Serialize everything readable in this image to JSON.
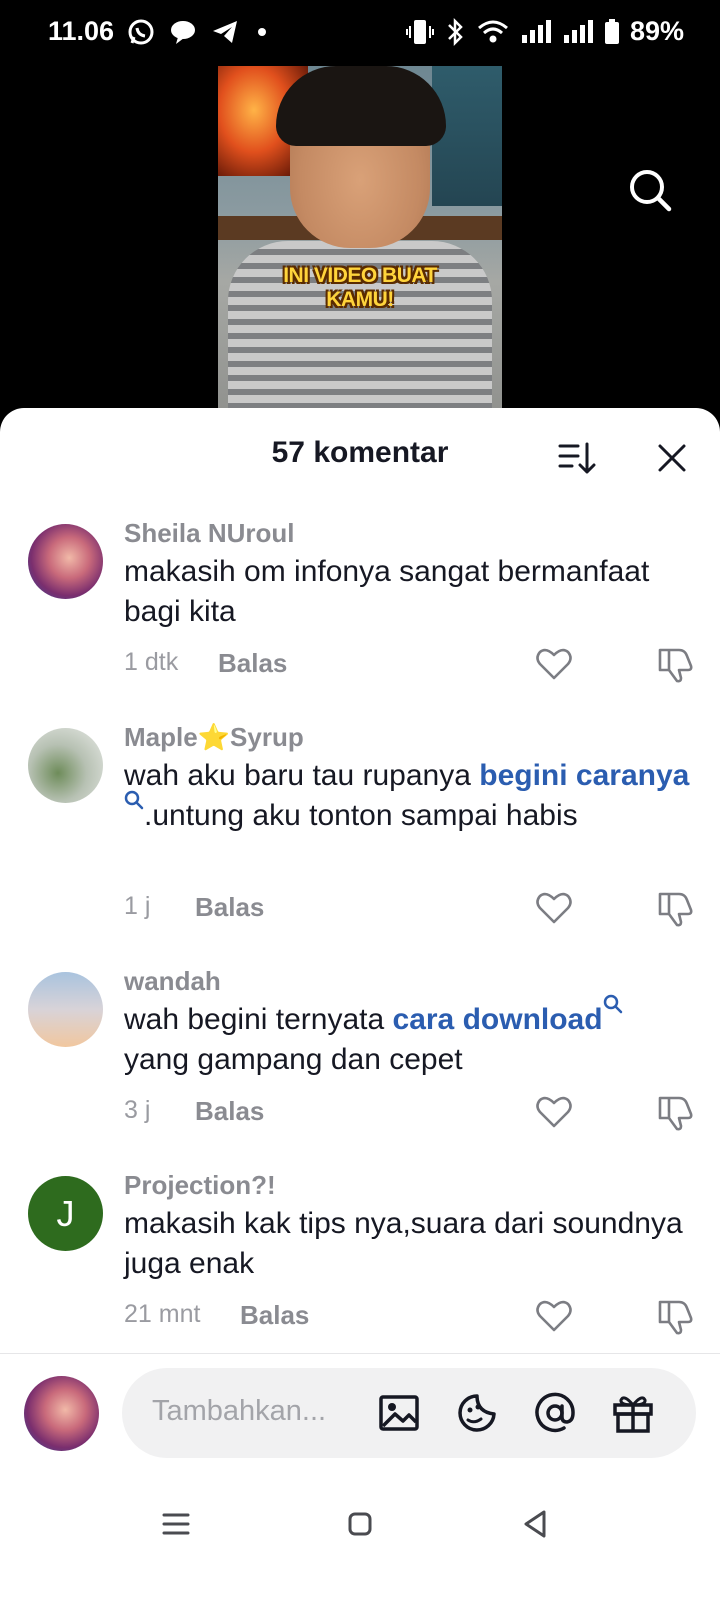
{
  "status_bar": {
    "time": "11.06",
    "battery": "89%",
    "icons": [
      "whatsapp-icon",
      "chat-icon",
      "telegram-icon",
      "dot-icon",
      "vibrate-icon",
      "bluetooth-icon",
      "wifi-icon",
      "signal-icon",
      "signal-icon",
      "battery-icon"
    ]
  },
  "video": {
    "caption_line1": "INI VIDEO BUAT",
    "caption_line2": "KAMU!",
    "search_icon": "search-icon"
  },
  "comments_panel": {
    "title": "57 komentar",
    "sort_icon": "sort-icon",
    "close_icon": "close-icon",
    "comments": [
      {
        "user": "Sheila NUroul",
        "text": "makasih om infonya sangat bermanfaat bagi kita",
        "time": "1 dtk",
        "reply_label": "Balas"
      },
      {
        "user": "Maple⭐Syrup",
        "text_before": "wah aku baru tau rupanya ",
        "link": "begini caranya",
        "text_after": ".untung aku tonton sampai habis",
        "time": "1 j",
        "reply_label": "Balas"
      },
      {
        "user": "wandah",
        "text_before": "wah begini ternyata ",
        "link": "cara download",
        "text_after": " yang gampang dan cepet",
        "time": "3 j",
        "reply_label": "Balas"
      },
      {
        "user": "Projection?!",
        "avatar_letter": "J",
        "text": "makasih kak tips nya,suara dari soundnya juga enak",
        "time": "21 mnt",
        "reply_label": "Balas"
      }
    ]
  },
  "input": {
    "placeholder": "Tambahkan...",
    "icons": [
      "image-icon",
      "emoji-sticker-icon",
      "mention-icon",
      "gift-icon"
    ]
  },
  "colors": {
    "link": "#2b5db0",
    "text": "#161823",
    "muted": "#8a8b91",
    "caption": "#ffd43b"
  }
}
